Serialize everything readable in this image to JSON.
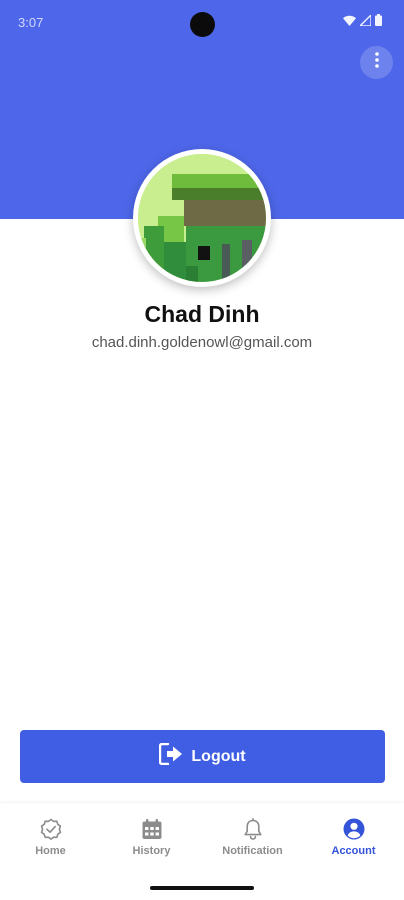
{
  "status_bar": {
    "time": "3:07",
    "icons": [
      "wifi-icon",
      "signal-icon",
      "battery-icon"
    ]
  },
  "header": {
    "color": "#4e67ea",
    "menu_icon": "more-vert-icon"
  },
  "profile": {
    "name": "Chad Dinh",
    "email": "chad.dinh.goldenowl@gmail.com",
    "avatar_icon": "pixel-art-avatar"
  },
  "logout": {
    "label": "Logout",
    "icon": "logout-icon",
    "color": "#3f5ee3"
  },
  "bottom_nav": {
    "active_color": "#3353d8",
    "inactive_color": "#8c8c8c",
    "items": [
      {
        "label": "Home",
        "icon": "check-badge-icon",
        "active": false
      },
      {
        "label": "History",
        "icon": "calendar-icon",
        "active": false
      },
      {
        "label": "Notification",
        "icon": "bell-icon",
        "active": false
      },
      {
        "label": "Account",
        "icon": "account-circle-icon",
        "active": true
      }
    ]
  }
}
